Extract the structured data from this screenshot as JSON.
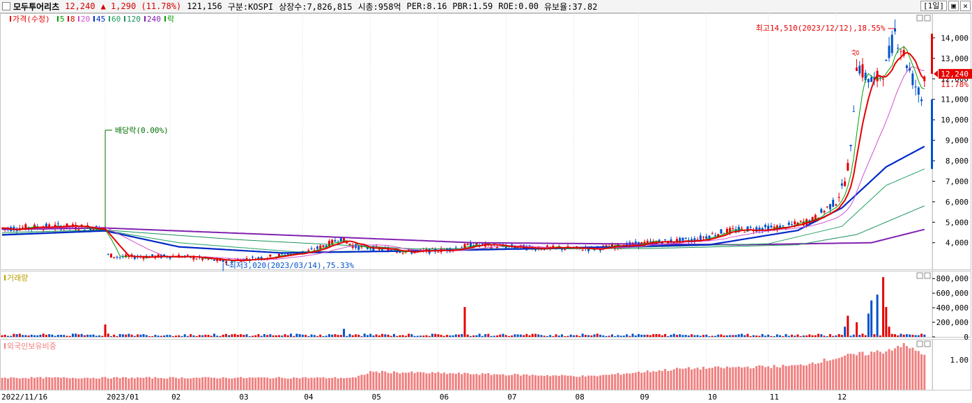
{
  "header": {
    "name": "모두투어리츠",
    "price": "12,240",
    "change": "▲ 1,290 (11.78%)",
    "volume": "121,156",
    "market": "구분:KOSPI",
    "listed": "상장수:7,826,815",
    "mcap": "시총:958억",
    "per": "PER:8.16",
    "pbr": "PBR:1.59",
    "roe": "ROE:0.00",
    "float": "유보율:37.82",
    "period": "[1일]"
  },
  "colors": {
    "up": "#e60000",
    "down": "#0052cc",
    "ma5": "#00a000",
    "ma8": "#e60000",
    "ma20": "#d050d0",
    "ma45": "#0028c8",
    "ma60": "#20a060",
    "ma120": "#1a8f5a",
    "ma240": "#8020b0",
    "foreign": "#f08080"
  },
  "chart_data": [
    {
      "type": "candlestick",
      "title": "",
      "legend": [
        "가격(수정)",
        "5",
        "8",
        "20",
        "45",
        "60",
        "120",
        "240",
        "락"
      ],
      "x_dates": [
        "2022/11/16",
        "2023/01",
        "02",
        "03",
        "04",
        "05",
        "06",
        "07",
        "08",
        "09",
        "10",
        "11",
        "12"
      ],
      "y_ticks": [
        "14,000",
        "13,000",
        "12,000",
        "11,000",
        "10,000",
        "9,000",
        "8,000",
        "7,000",
        "6,000",
        "5,000",
        "4,000"
      ],
      "ylim": [
        2700,
        15200
      ],
      "price_path": [
        [
          0,
          4700
        ],
        [
          20,
          4800
        ],
        [
          35,
          4700
        ],
        [
          36,
          3400
        ],
        [
          40,
          3300
        ],
        [
          60,
          3350
        ],
        [
          75,
          3100
        ],
        [
          90,
          3300
        ],
        [
          105,
          3600
        ],
        [
          115,
          4200
        ],
        [
          120,
          3800
        ],
        [
          140,
          3550
        ],
        [
          150,
          3650
        ],
        [
          160,
          3900
        ],
        [
          180,
          3750
        ],
        [
          200,
          3700
        ],
        [
          210,
          3850
        ],
        [
          220,
          4000
        ],
        [
          235,
          4150
        ],
        [
          245,
          4550
        ],
        [
          255,
          4700
        ],
        [
          265,
          4750
        ],
        [
          275,
          5100
        ],
        [
          280,
          5700
        ],
        [
          283,
          6000
        ],
        [
          286,
          7000
        ],
        [
          288,
          8500
        ],
        [
          290,
          12800
        ],
        [
          293,
          12100
        ],
        [
          296,
          11800
        ],
        [
          300,
          12600
        ],
        [
          303,
          14300
        ],
        [
          306,
          13200
        ],
        [
          309,
          12000
        ],
        [
          312,
          11000
        ],
        [
          313,
          12240
        ]
      ],
      "ma_lines": {
        "45": [
          [
            0,
            4380
          ],
          [
            35,
            4580
          ],
          [
            60,
            3800
          ],
          [
            95,
            3500
          ],
          [
            160,
            3650
          ],
          [
            240,
            3900
          ],
          [
            270,
            4600
          ],
          [
            285,
            5700
          ],
          [
            300,
            7700
          ],
          [
            313,
            8700
          ]
        ],
        "60": [
          [
            0,
            4420
          ],
          [
            35,
            4600
          ],
          [
            60,
            4000
          ],
          [
            100,
            3550
          ],
          [
            200,
            3720
          ],
          [
            260,
            3950
          ],
          [
            285,
            4800
          ],
          [
            300,
            6800
          ],
          [
            313,
            7600
          ]
        ],
        "120": [
          [
            0,
            4500
          ],
          [
            35,
            4620
          ],
          [
            80,
            4150
          ],
          [
            140,
            3700
          ],
          [
            220,
            3720
          ],
          [
            270,
            3900
          ],
          [
            290,
            4400
          ],
          [
            313,
            5800
          ]
        ],
        "240": [
          [
            0,
            4650
          ],
          [
            35,
            4720
          ],
          [
            100,
            4350
          ],
          [
            160,
            4000
          ],
          [
            250,
            3900
          ],
          [
            295,
            4000
          ],
          [
            313,
            4650
          ]
        ]
      },
      "annotations": {
        "high": "최고14,510(2023/12/12),18.55%",
        "low": "최저3,020(2023/03/14),75.33%",
        "dividend": "배당락(0.00%)",
        "upper_limit": "상",
        "last_price": "12,240",
        "last_pct": "11.78%"
      }
    },
    {
      "type": "bar",
      "title": "거래량",
      "y_ticks": [
        "800,000",
        "600,000",
        "400,000",
        "200,000",
        "0"
      ],
      "ylim": [
        0,
        850000
      ],
      "spikes": [
        [
          35,
          170000
        ],
        [
          116,
          110000
        ],
        [
          157,
          410000
        ],
        [
          286,
          140000
        ],
        [
          287,
          290000
        ],
        [
          290,
          200000
        ],
        [
          294,
          320000
        ],
        [
          295,
          500000
        ],
        [
          297,
          580000
        ],
        [
          299,
          820000
        ],
        [
          300,
          410000
        ],
        [
          301,
          140000
        ]
      ],
      "baseline": 30000
    },
    {
      "type": "bar",
      "title": "외국인보유비중",
      "y_ticks": [
        "1.00"
      ],
      "ylim": [
        0,
        1.6
      ],
      "path": [
        [
          0,
          0.4
        ],
        [
          120,
          0.4
        ],
        [
          125,
          0.6
        ],
        [
          200,
          0.45
        ],
        [
          230,
          0.7
        ],
        [
          270,
          0.8
        ],
        [
          285,
          1.1
        ],
        [
          300,
          1.3
        ],
        [
          305,
          1.5
        ],
        [
          313,
          1.2
        ]
      ]
    }
  ],
  "x_axis_labels": [
    "2022/11/16",
    "2023/01",
    "02",
    "03",
    "04",
    "05",
    "06",
    "07",
    "08",
    "09",
    "10",
    "11",
    "12"
  ]
}
